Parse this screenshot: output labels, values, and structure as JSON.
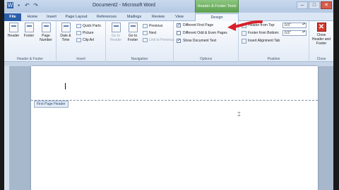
{
  "window": {
    "title": "Document2 - Microsoft Word",
    "context_tool_header": "Header & Footer Tools",
    "minimize_glyph": "–",
    "maximize_glyph": "□",
    "close_glyph": "✕"
  },
  "tabs": [
    {
      "label": "File"
    },
    {
      "label": "Home"
    },
    {
      "label": "Insert"
    },
    {
      "label": "Page Layout"
    },
    {
      "label": "References"
    },
    {
      "label": "Mailings"
    },
    {
      "label": "Review"
    },
    {
      "label": "View"
    },
    {
      "label": "Design"
    }
  ],
  "groups": {
    "header_footer": {
      "label": "Header & Footer",
      "header": "Header",
      "footer": "Footer",
      "page_number": "Page Number"
    },
    "insert": {
      "label": "Insert",
      "date_time": "Date & Time",
      "quick_parts": "Quick Parts",
      "picture": "Picture",
      "clip_art": "Clip Art"
    },
    "navigation": {
      "label": "Navigation",
      "goto_header": "Go to Header",
      "goto_footer": "Go to Footer",
      "previous": "Previous",
      "next": "Next",
      "link_previous": "Link to Previous"
    },
    "options": {
      "label": "Options",
      "different_first_page": "Different First Page",
      "different_odd_even": "Different Odd & Even Pages",
      "show_document_text": "Show Document Text",
      "first_checked": true,
      "odd_even_checked": false,
      "show_text_checked": true
    },
    "position": {
      "label": "Position",
      "header_from_top": "Header from Top:",
      "footer_from_bottom": "Footer from Bottom:",
      "insert_alignment_tab": "Insert Alignment Tab",
      "header_value": "0.5\"",
      "footer_value": "0.5\""
    },
    "close": {
      "label": "Close",
      "close_header_footer": "Close Header and Footer"
    }
  },
  "document": {
    "header_tag": "First Page Header"
  },
  "colors": {
    "annotation_arrow": "#d8202a",
    "file_tab": "#2a5ea8",
    "context_tab": "#6fae62"
  }
}
